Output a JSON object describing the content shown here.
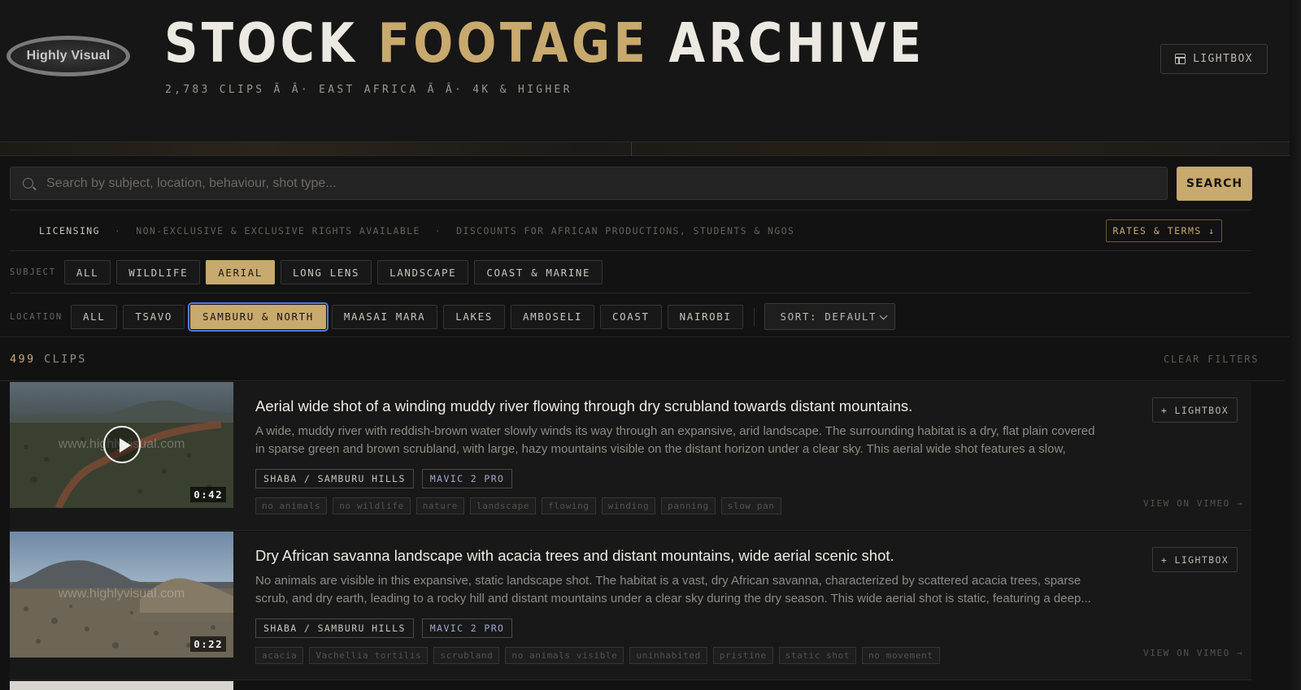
{
  "header": {
    "logo_text": "Highly Visual",
    "title_part1": "STOCK",
    "title_accent": "FOOTAGE",
    "title_part3": "ARCHIVE",
    "subtitle": "2,783 CLIPS Ã Â· EAST AFRICA Ã Â· 4K & HIGHER",
    "lightbox_label": "LIGHTBOX"
  },
  "search": {
    "placeholder": "Search by subject, location, behaviour, shot type...",
    "value": "",
    "button_label": "SEARCH"
  },
  "licensing": {
    "label": "LICENSING",
    "dot": "·",
    "note1": "NON-EXCLUSIVE & EXCLUSIVE RIGHTS AVAILABLE",
    "note2": "DISCOUNTS FOR AFRICAN PRODUCTIONS, STUDENTS & NGOS",
    "rates_label": "RATES & TERMS ↓"
  },
  "filters": {
    "subject_label": "SUBJECT",
    "subject_chips": [
      "ALL",
      "WILDLIFE",
      "AERIAL",
      "LONG LENS",
      "LANDSCAPE",
      "COAST & MARINE"
    ],
    "subject_active": "AERIAL",
    "location_label": "LOCATION",
    "location_chips": [
      "ALL",
      "TSAVO",
      "SAMBURU & NORTH",
      "MAASAI MARA",
      "LAKES",
      "AMBOSELI",
      "COAST",
      "NAIROBI"
    ],
    "location_active": "SAMBURU & NORTH",
    "sort_label": "SORT: DEFAULT"
  },
  "results": {
    "count": "499",
    "label": "CLIPS",
    "clear_label": "CLEAR FILTERS"
  },
  "clips": [
    {
      "title": "Aerial wide shot of a winding muddy river flowing through dry scrubland towards distant mountains.",
      "description": "A wide, muddy river with reddish-brown water slowly winds its way through an expansive, arid landscape. The surrounding habitat is a dry, flat plain covered in sparse green and brown scrubland, with large, hazy mountains visible on the distant horizon under a clear sky. This aerial wide shot features a slow, stead...",
      "duration": "0:42",
      "watermark": "www.highlyvisual.com",
      "location_tag": "SHABA / SAMBURU HILLS",
      "camera_tag": "MAVIC 2 PRO",
      "keywords": [
        "no animals",
        "no wildlife",
        "nature",
        "landscape",
        "flowing",
        "winding",
        "panning",
        "slow pan"
      ],
      "lightbox_label": "+ LIGHTBOX",
      "vimeo_label": "VIEW ON VIMEO →"
    },
    {
      "title": "Dry African savanna landscape with acacia trees and distant mountains, wide aerial scenic shot.",
      "description": "No animals are visible in this expansive, static landscape shot. The habitat is a vast, dry African savanna, characterized by scattered acacia trees, sparse scrub, and dry earth, leading to a rocky hill and distant mountains under a clear sky during the dry season. This wide aerial shot is static, featuring a deep...",
      "duration": "0:22",
      "watermark": "www.highlyvisual.com",
      "location_tag": "SHABA / SAMBURU HILLS",
      "camera_tag": "MAVIC 2 PRO",
      "keywords": [
        "acacia",
        "Vachellia tortilis",
        "scrubland",
        "no animals visible",
        "uninhabited",
        "pristine",
        "static shot",
        "no movement"
      ],
      "lightbox_label": "+ LIGHTBOX",
      "vimeo_label": "VIEW ON VIMEO →"
    }
  ],
  "colors": {
    "accent": "#c8a96e",
    "background": "#121212",
    "focus_ring": "#4f7fd9"
  },
  "icons": [
    "lightbox-icon",
    "search-icon",
    "chevron-down-icon",
    "play-icon"
  ]
}
